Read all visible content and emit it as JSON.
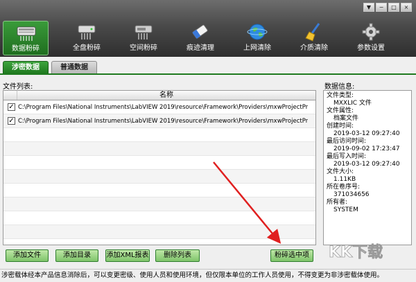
{
  "window": {
    "controls": [
      "▼",
      "−",
      "□",
      "×"
    ]
  },
  "toolbar": {
    "items": [
      {
        "label": "数据粉碎",
        "icon": "keyboard-shredder-icon",
        "active": true
      },
      {
        "label": "全盘粉碎",
        "icon": "hard-drive-shredder-icon"
      },
      {
        "label": "空间粉碎",
        "icon": "disk-space-shredder-icon"
      },
      {
        "label": "痕迹清理",
        "icon": "eraser-icon"
      },
      {
        "label": "上网清除",
        "icon": "globe-icon"
      },
      {
        "label": "介质清除",
        "icon": "broom-icon"
      },
      {
        "label": "参数设置",
        "icon": "gear-icon"
      }
    ]
  },
  "tabs": [
    {
      "label": "涉密数据",
      "active": true
    },
    {
      "label": "普通数据",
      "active": false
    }
  ],
  "file_list": {
    "label": "文件列表:",
    "column_name": "名称",
    "rows": [
      {
        "checked": true,
        "path": "C:\\Program Files\\National Instruments\\LabVIEW 2019\\resource\\Framework\\Providers\\mxwProjectPro..."
      },
      {
        "checked": true,
        "path": "C:\\Program Files\\National Instruments\\LabVIEW 2019\\resource\\Framework\\Providers\\mxwProjectPro..."
      }
    ]
  },
  "info": {
    "label": "数据信息:",
    "lines": [
      {
        "text": "文件类型:",
        "value": false
      },
      {
        "text": "MXXLIC 文件",
        "value": true
      },
      {
        "text": "文件属性:",
        "value": false
      },
      {
        "text": "档案文件",
        "value": true
      },
      {
        "text": "创建时间:",
        "value": false
      },
      {
        "text": "2019-03-12 09:27:40",
        "value": true
      },
      {
        "text": "最后访问时间:",
        "value": false
      },
      {
        "text": "2019-09-02 17:23:47",
        "value": true
      },
      {
        "text": "最后写入时间:",
        "value": false
      },
      {
        "text": "2019-03-12 09:27:40",
        "value": true
      },
      {
        "text": "文件大小:",
        "value": false
      },
      {
        "text": "1.11KB",
        "value": true
      },
      {
        "text": "所在卷序号:",
        "value": false
      },
      {
        "text": "371034656",
        "value": true
      },
      {
        "text": "所有者:",
        "value": false
      },
      {
        "text": "SYSTEM",
        "value": true
      }
    ]
  },
  "buttons": {
    "add_file": "添加文件",
    "add_dir": "添加目录",
    "add_xml": "添加XML报表",
    "delete_list": "删除列表",
    "shred_selected": "粉碎选中项"
  },
  "status_text": "涉密载体经本产品信息消除后，可以变更密级、使用人员和使用环境，但仅限本单位的工作人员使用，不得变更为非涉密载体使用。",
  "watermark": "KK下载",
  "colors": {
    "accent_green": "#2e8b2e",
    "arrow_red": "#e02020"
  }
}
